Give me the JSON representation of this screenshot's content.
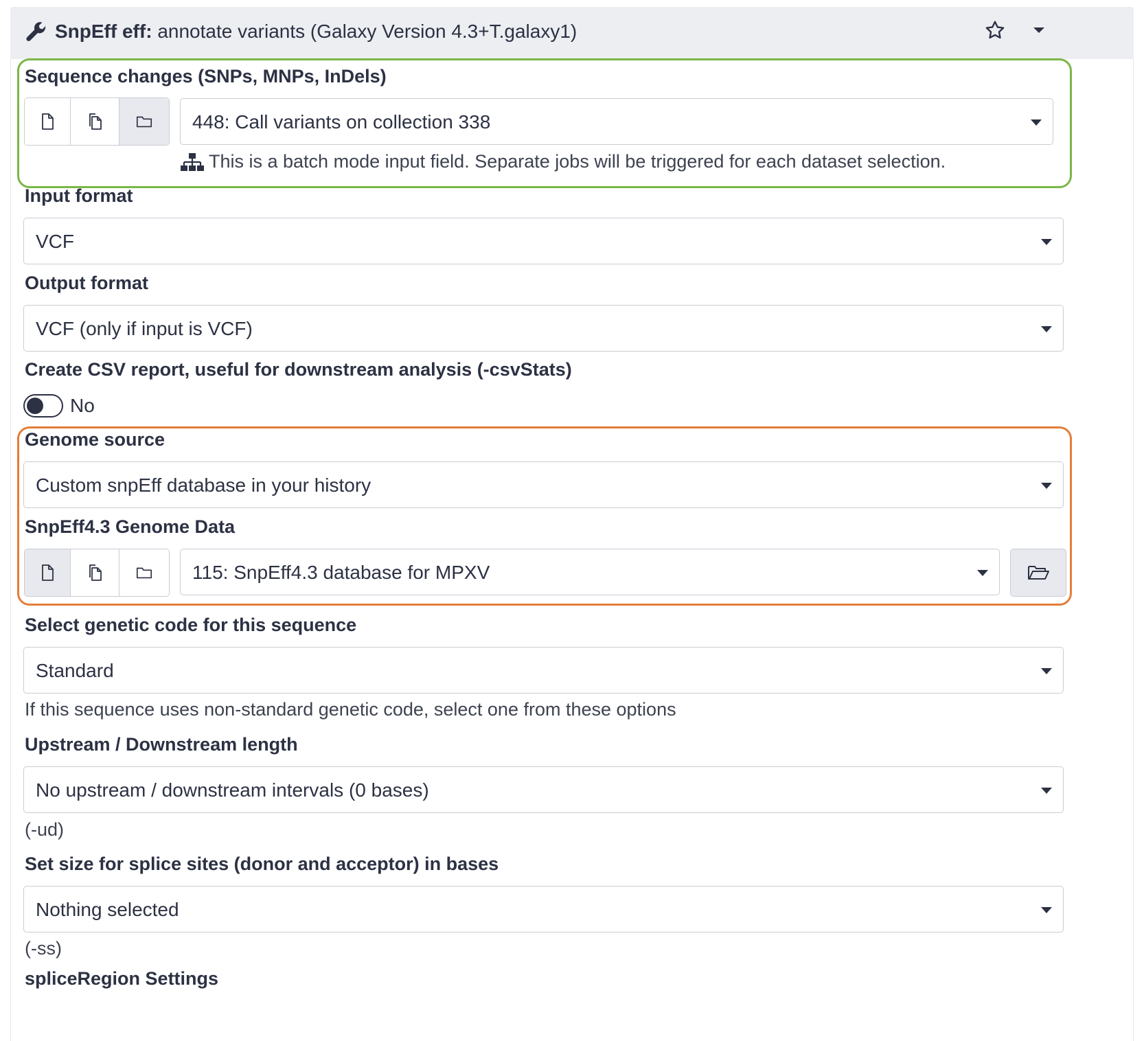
{
  "tool": {
    "name": "SnpEff eff:",
    "description": "annotate variants (Galaxy Version 4.3+T.galaxy1)",
    "wrench_icon": "wrench-icon",
    "star_icon": "star-icon",
    "menu_icon": "caret-down-icon"
  },
  "fields": {
    "sequence_changes": {
      "label": "Sequence changes (SNPs, MNPs, InDels)",
      "value": "448: Call variants on collection 338",
      "batch_note": "This is a batch mode input field. Separate jobs will be triggered for each dataset selection.",
      "active_mode": "collection"
    },
    "input_format": {
      "label": "Input format",
      "value": "VCF"
    },
    "output_format": {
      "label": "Output format",
      "value": "VCF (only if input is VCF)"
    },
    "csv_report": {
      "label": "Create CSV report, useful for downstream analysis (-csvStats)",
      "value": "No",
      "checked": false
    },
    "genome_source": {
      "label": "Genome source",
      "value": "Custom snpEff database in your history"
    },
    "genome_data": {
      "label": "SnpEff4.3 Genome Data",
      "value": "115: SnpEff4.3 database for MPXV",
      "active_mode": "single"
    },
    "genetic_code": {
      "label": "Select genetic code for this sequence",
      "value": "Standard",
      "help": "If this sequence uses non-standard genetic code, select one from these options"
    },
    "updown_length": {
      "label": "Upstream / Downstream length",
      "value": "No upstream / downstream intervals (0 bases)",
      "help": "(-ud)"
    },
    "splice_size": {
      "label": "Set size for splice sites (donor and acceptor) in bases",
      "value": "Nothing selected",
      "help": "(-ss)"
    },
    "next_section": {
      "label": "spliceRegion Settings"
    }
  },
  "colors": {
    "highlight_green": "#7ab648",
    "highlight_orange": "#e47d3a",
    "header_bg": "#eceef2",
    "text": "#2c3143"
  }
}
